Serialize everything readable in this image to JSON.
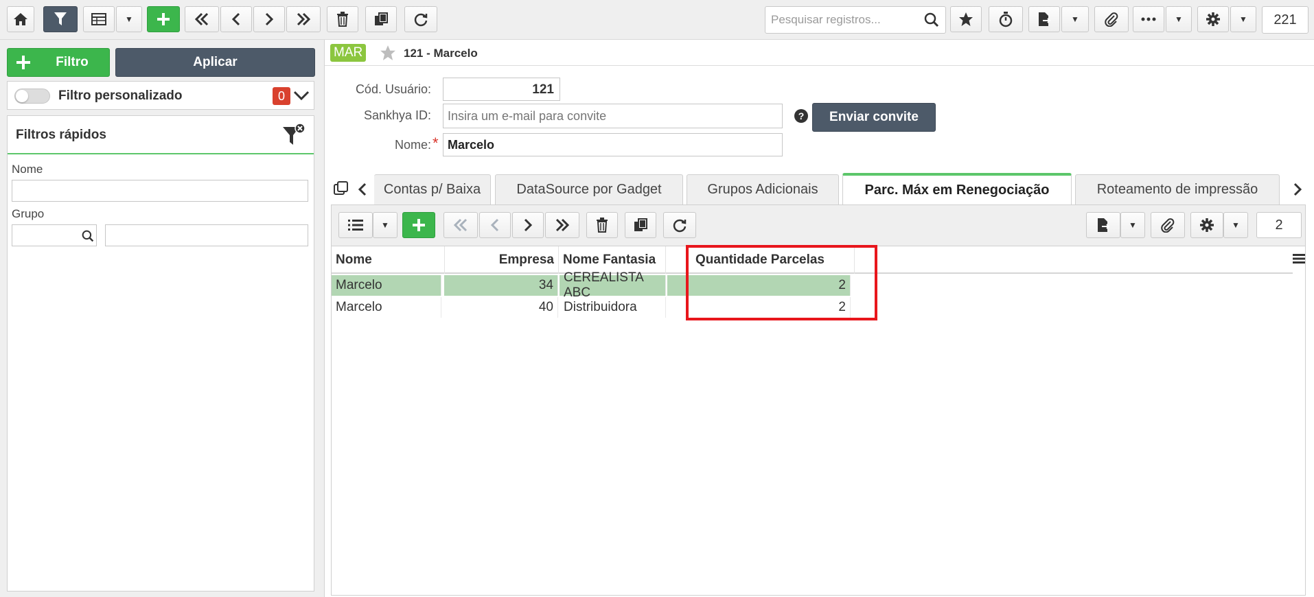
{
  "toolbar": {
    "search_placeholder": "Pesquisar registros...",
    "record_count": "221",
    "icons": [
      "home-icon",
      "filter-icon",
      "grid-icon",
      "add-icon",
      "first-icon",
      "prev-icon",
      "next-icon",
      "last-icon",
      "trash-icon",
      "copy-icon",
      "refresh-icon",
      "search-icon",
      "star-icon",
      "timer-icon",
      "export-icon",
      "attach-icon",
      "more-icon",
      "gear-icon"
    ]
  },
  "filter_panel": {
    "filter_label": "Filtro",
    "apply_label": "Aplicar",
    "custom_filter_label": "Filtro personalizado",
    "custom_filter_count": "0",
    "quick_filters_title": "Filtros rápidos",
    "name_label": "Nome",
    "group_label": "Grupo"
  },
  "record": {
    "badge": "MAR",
    "title": "121 - Marcelo",
    "user_code_label": "Cód. Usuário:",
    "user_code": "121",
    "sankhya_label": "Sankhya ID:",
    "sankhya_placeholder": "Insira um e-mail para convite",
    "invite_label": "Enviar convite",
    "name_label": "Nome:",
    "required_mark": "*",
    "name_value": "Marcelo"
  },
  "tabs": [
    {
      "label": "Contas p/ Baixa"
    },
    {
      "label": "DataSource por Gadget"
    },
    {
      "label": "Grupos Adicionais"
    },
    {
      "label": "Parc. Máx em Renegociação",
      "active": true
    },
    {
      "label": "Roteamento de impressão"
    }
  ],
  "grid": {
    "record_count": "2",
    "columns": [
      "Nome",
      "Empresa",
      "Nome Fantasia",
      "Quantidade Parcelas"
    ],
    "rows": [
      {
        "nome": "Marcelo",
        "empresa": "34",
        "fantasia": "CEREALISTA ABC",
        "parcelas": "2"
      },
      {
        "nome": "Marcelo",
        "empresa": "40",
        "fantasia": "Distribuidora",
        "parcelas": "2"
      }
    ]
  },
  "colors": {
    "accent_green": "#3cb64c",
    "dark_button": "#4d5a69",
    "highlight": "#e8161c",
    "badge": "#8cc63f",
    "selected_row": "#b2d6b3"
  }
}
